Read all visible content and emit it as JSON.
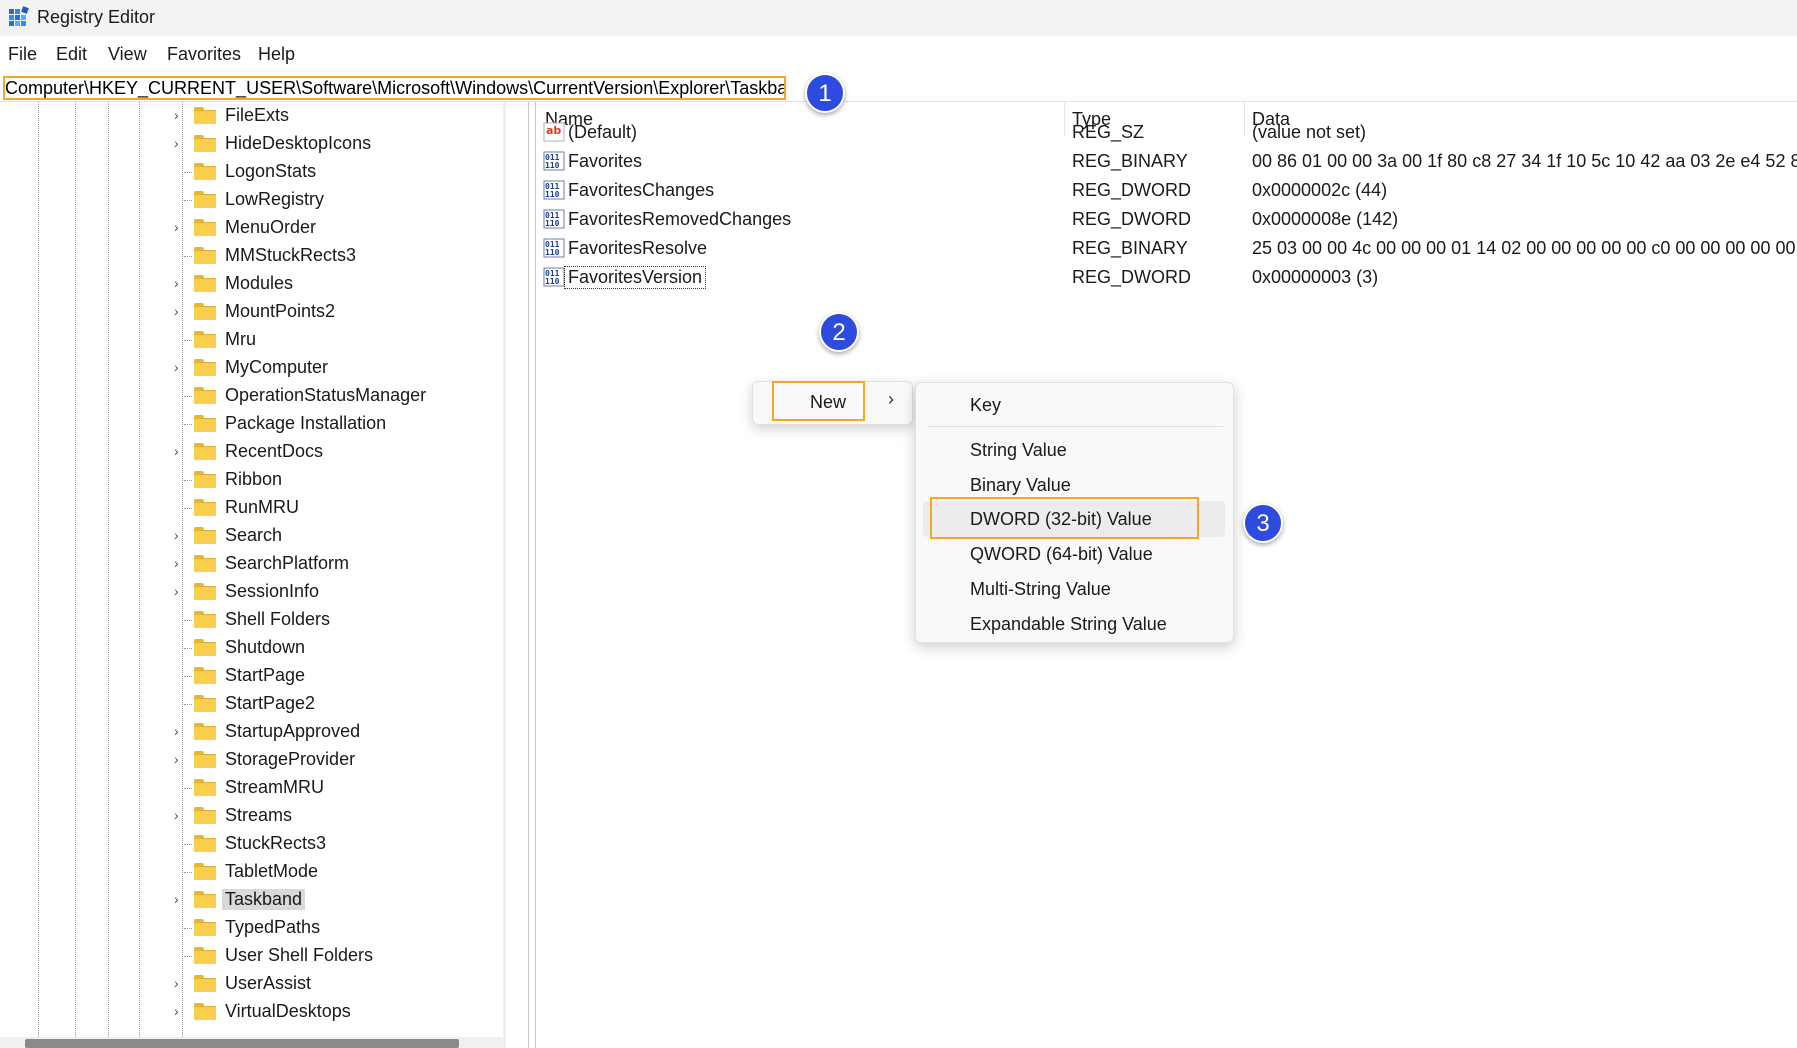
{
  "window": {
    "title": "Registry Editor",
    "icon": "regedit-icon"
  },
  "menubar": {
    "items": [
      "File",
      "Edit",
      "View",
      "Favorites",
      "Help"
    ]
  },
  "address": {
    "path": "Computer\\HKEY_CURRENT_USER\\Software\\Microsoft\\Windows\\CurrentVersion\\Explorer\\Taskband"
  },
  "callouts": [
    "1",
    "2",
    "3"
  ],
  "tree": {
    "items": [
      {
        "label": "FileExts",
        "expandable": true
      },
      {
        "label": "HideDesktopIcons",
        "expandable": true
      },
      {
        "label": "LogonStats",
        "expandable": false
      },
      {
        "label": "LowRegistry",
        "expandable": false
      },
      {
        "label": "MenuOrder",
        "expandable": true
      },
      {
        "label": "MMStuckRects3",
        "expandable": false
      },
      {
        "label": "Modules",
        "expandable": true
      },
      {
        "label": "MountPoints2",
        "expandable": true
      },
      {
        "label": "Mru",
        "expandable": false
      },
      {
        "label": "MyComputer",
        "expandable": true
      },
      {
        "label": "OperationStatusManager",
        "expandable": false
      },
      {
        "label": "Package Installation",
        "expandable": false
      },
      {
        "label": "RecentDocs",
        "expandable": true
      },
      {
        "label": "Ribbon",
        "expandable": false
      },
      {
        "label": "RunMRU",
        "expandable": false
      },
      {
        "label": "Search",
        "expandable": true
      },
      {
        "label": "SearchPlatform",
        "expandable": true
      },
      {
        "label": "SessionInfo",
        "expandable": true
      },
      {
        "label": "Shell Folders",
        "expandable": false
      },
      {
        "label": "Shutdown",
        "expandable": false
      },
      {
        "label": "StartPage",
        "expandable": false
      },
      {
        "label": "StartPage2",
        "expandable": false
      },
      {
        "label": "StartupApproved",
        "expandable": true
      },
      {
        "label": "StorageProvider",
        "expandable": true
      },
      {
        "label": "StreamMRU",
        "expandable": false
      },
      {
        "label": "Streams",
        "expandable": true
      },
      {
        "label": "StuckRects3",
        "expandable": false
      },
      {
        "label": "TabletMode",
        "expandable": false
      },
      {
        "label": "Taskband",
        "expandable": true,
        "selected": true
      },
      {
        "label": "TypedPaths",
        "expandable": false
      },
      {
        "label": "User Shell Folders",
        "expandable": false
      },
      {
        "label": "UserAssist",
        "expandable": true
      },
      {
        "label": "VirtualDesktops",
        "expandable": true
      }
    ]
  },
  "list": {
    "columns": {
      "name": "Name",
      "type": "Type",
      "data": "Data"
    },
    "rows": [
      {
        "icon": "string-value-icon",
        "name": "(Default)",
        "type": "REG_SZ",
        "data": "(value not set)"
      },
      {
        "icon": "binary-value-icon",
        "name": "Favorites",
        "type": "REG_BINARY",
        "data": "00 86 01 00 00 3a 00 1f 80 c8 27 34 1f 10 5c 10 42 aa 03 2e e4 52 8"
      },
      {
        "icon": "binary-value-icon",
        "name": "FavoritesChanges",
        "type": "REG_DWORD",
        "data": "0x0000002c (44)"
      },
      {
        "icon": "binary-value-icon",
        "name": "FavoritesRemovedChanges",
        "type": "REG_DWORD",
        "data": "0x0000008e (142)"
      },
      {
        "icon": "binary-value-icon",
        "name": "FavoritesResolve",
        "type": "REG_BINARY",
        "data": "25 03 00 00 4c 00 00 00 01 14 02 00 00 00 00 00 c0 00 00 00 00 00."
      },
      {
        "icon": "binary-value-icon",
        "name": "FavoritesVersion",
        "type": "REG_DWORD",
        "data": "0x00000003 (3)"
      }
    ]
  },
  "context_menu": {
    "new_label": "New",
    "submenu": [
      "Key",
      "String Value",
      "Binary Value",
      "DWORD (32-bit) Value",
      "QWORD (64-bit) Value",
      "Multi-String Value",
      "Expandable String Value"
    ],
    "highlighted": "DWORD (32-bit) Value"
  },
  "colors": {
    "highlight_outline": "#f5a623",
    "callout": "#2e4be0",
    "folder": "#f8ce4a"
  }
}
